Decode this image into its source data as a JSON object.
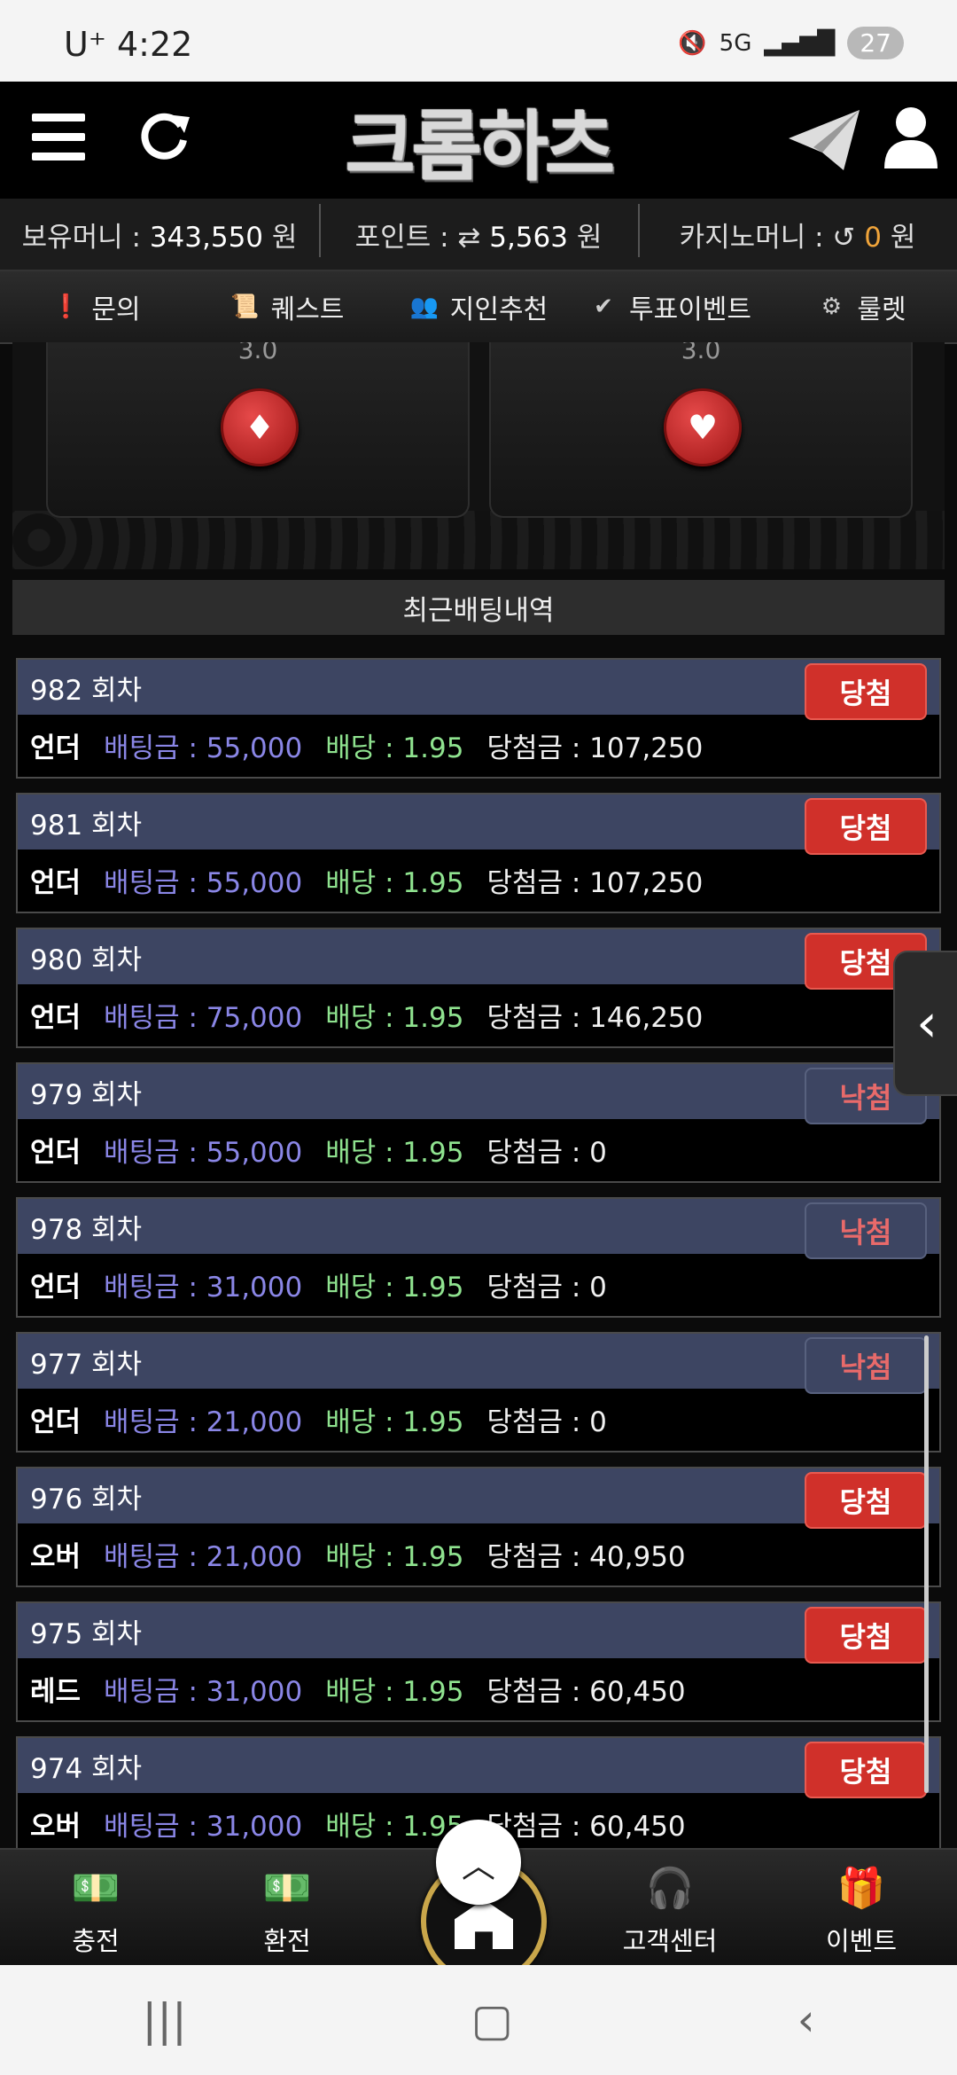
{
  "status": {
    "carrier": "U⁺",
    "time": "4:22",
    "network": "5G",
    "battery": "27"
  },
  "header": {
    "logo_text": "크롬하츠"
  },
  "money": {
    "holding_label": "보유머니 : ",
    "holding_value": "343,550",
    "holding_unit": " 원",
    "point_label": "포인트 : ",
    "point_value": "5,563",
    "point_unit": " 원",
    "casino_label": "카지노머니 : ",
    "casino_value": "0",
    "casino_unit": " 원"
  },
  "nav": [
    {
      "label": "문의",
      "icon": "alert-icon"
    },
    {
      "label": "퀘스트",
      "icon": "scroll-icon"
    },
    {
      "label": "지인추천",
      "icon": "people-icon"
    },
    {
      "label": "투표이벤트",
      "icon": "check-icon"
    },
    {
      "label": "룰렛",
      "icon": "roulette-icon"
    }
  ],
  "game": {
    "cards": [
      {
        "odd": "3.0",
        "suit": "♦"
      },
      {
        "odd": "3.0",
        "suit": "♥"
      }
    ]
  },
  "history": {
    "title": "최근배팅내역",
    "rows": [
      {
        "round": "982 회차",
        "pick": "언더",
        "bet": "배팅금 : 55,000",
        "odds": "배당 : 1.95",
        "win": "당첨금 : 107,250",
        "result": "당첨",
        "hit": true
      },
      {
        "round": "981 회차",
        "pick": "언더",
        "bet": "배팅금 : 55,000",
        "odds": "배당 : 1.95",
        "win": "당첨금 : 107,250",
        "result": "당첨",
        "hit": true
      },
      {
        "round": "980 회차",
        "pick": "언더",
        "bet": "배팅금 : 75,000",
        "odds": "배당 : 1.95",
        "win": "당첨금 : 146,250",
        "result": "당첨",
        "hit": true
      },
      {
        "round": "979 회차",
        "pick": "언더",
        "bet": "배팅금 : 55,000",
        "odds": "배당 : 1.95",
        "win": "당첨금 : 0",
        "result": "낙첨",
        "hit": false
      },
      {
        "round": "978 회차",
        "pick": "언더",
        "bet": "배팅금 : 31,000",
        "odds": "배당 : 1.95",
        "win": "당첨금 : 0",
        "result": "낙첨",
        "hit": false
      },
      {
        "round": "977 회차",
        "pick": "언더",
        "bet": "배팅금 : 21,000",
        "odds": "배당 : 1.95",
        "win": "당첨금 : 0",
        "result": "낙첨",
        "hit": false
      },
      {
        "round": "976 회차",
        "pick": "오버",
        "bet": "배팅금 : 21,000",
        "odds": "배당 : 1.95",
        "win": "당첨금 : 40,950",
        "result": "당첨",
        "hit": true
      },
      {
        "round": "975 회차",
        "pick": "레드",
        "bet": "배팅금 : 31,000",
        "odds": "배당 : 1.95",
        "win": "당첨금 : 60,450",
        "result": "당첨",
        "hit": true
      },
      {
        "round": "974 회차",
        "pick": "오버",
        "bet": "배팅금 : 31,000",
        "odds": "배당 : 1.95",
        "win": "당첨금 : 60,450",
        "result": "당첨",
        "hit": true
      }
    ]
  },
  "bottom_nav": [
    {
      "label": "충전",
      "icon": "deposit-icon"
    },
    {
      "label": "환전",
      "icon": "withdraw-icon"
    },
    {
      "label": "",
      "icon": "home-icon"
    },
    {
      "label": "고객센터",
      "icon": "support-icon"
    },
    {
      "label": "이벤트",
      "icon": "gift-icon"
    }
  ],
  "colors": {
    "hit": "#d0302a",
    "miss_text": "#e86a6a",
    "row_header": "#3d4562",
    "bet": "#8a86e6",
    "odds": "#8fe38f",
    "accent_gold": "#c9a64a"
  }
}
